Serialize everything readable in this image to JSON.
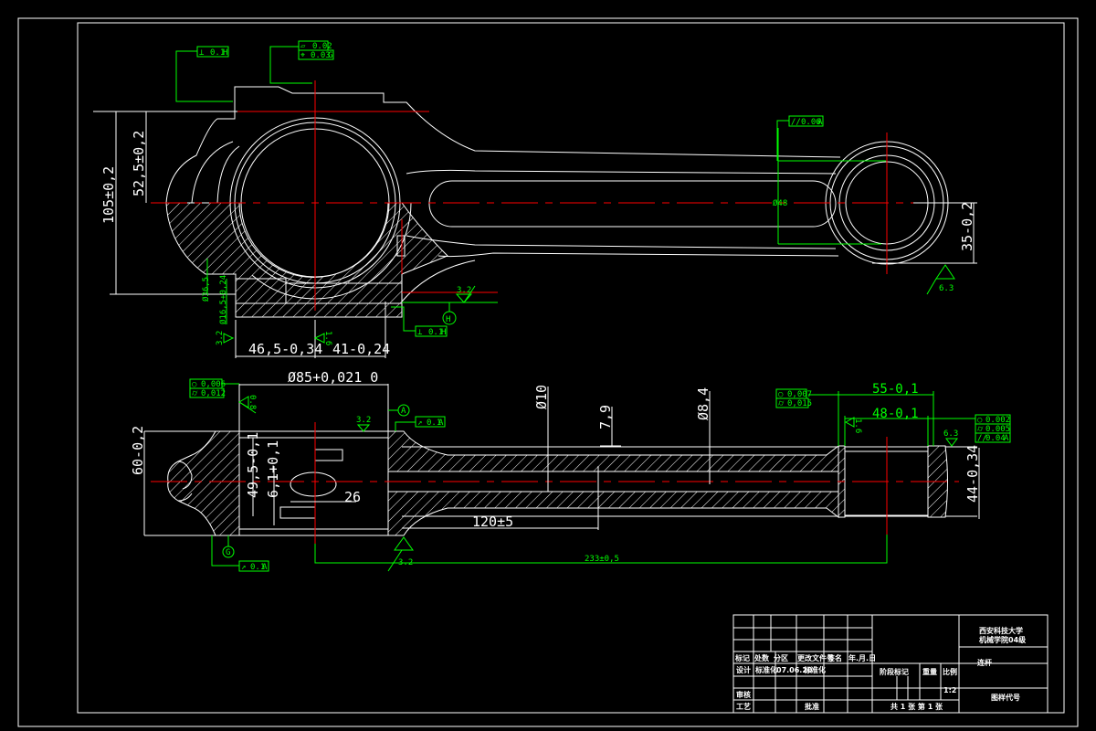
{
  "drawing": {
    "colors": {
      "outline": "#ffffff",
      "centerline": "#ff0000",
      "annotation": "#00ff00",
      "background": "#000000"
    },
    "top_view": {
      "dims": {
        "total_height": "105±0,2",
        "half_height": "52,5±0,2",
        "left_len": "46,5-0,34",
        "right_len": "41-0,24",
        "small_end_height": "35-0,2",
        "bolt_dia_a": "Ø16,5+0,24",
        "bolt_dia_b": "Ø36,5",
        "small_dia": "Ø48"
      },
      "tolerance_frames": [
        {
          "symbol": "⊥",
          "value": "0.1",
          "datum": "H"
        },
        {
          "symbol": "▱",
          "value": "0.02",
          "datum": ""
        },
        {
          "symbol": "⌖",
          "value": "0.03",
          "datum": "G"
        },
        {
          "symbol": "//",
          "value": "0.06",
          "datum": "A"
        },
        {
          "symbol": "⊥",
          "value": "0.1",
          "datum": "H"
        }
      ],
      "roughness": [
        "3.2",
        "3.2",
        "1.6",
        "6.3"
      ],
      "datum": "H"
    },
    "front_view": {
      "dims": {
        "bore": "Ø85+0,021 0",
        "height": "60-0,2",
        "inner": "49,5-0,1",
        "key": "6,1+0,1",
        "width26": "26",
        "oil_hole": "Ø10",
        "d79": "7,9",
        "d84": "Ø8,4",
        "shank": "120±5",
        "center_dist": "233±0,5",
        "small_55": "55-0,1",
        "small_48": "48-0,1",
        "small_44": "44-0,34"
      },
      "tolerance_frames": [
        {
          "symbol": "○",
          "value": "0,006",
          "datum": ""
        },
        {
          "symbol": "⌭",
          "value": "0,012",
          "datum": ""
        },
        {
          "symbol": "↗",
          "value": "0.1",
          "datum": "A"
        },
        {
          "symbol": "↗",
          "value": "0.1",
          "datum": "A"
        },
        {
          "symbol": "○",
          "value": "0,007",
          "datum": ""
        },
        {
          "symbol": "⌭",
          "value": "0,015",
          "datum": ""
        },
        {
          "symbol": "○",
          "value": "0.002",
          "datum": ""
        },
        {
          "symbol": "⌭",
          "value": "0.005",
          "datum": ""
        },
        {
          "symbol": "//",
          "value": "0.04",
          "datum": "A"
        }
      ],
      "roughness": [
        "0.8",
        "3.2",
        "3.2",
        "1.6",
        "6.3"
      ],
      "datums": [
        "A",
        "G"
      ]
    },
    "title_block": {
      "headers": [
        "标记",
        "处数",
        "分区",
        "更改文件号",
        "签名",
        "年.月.日"
      ],
      "row_design": [
        "设计",
        "标准化",
        "07.06.20",
        "标准化"
      ],
      "review": "审核",
      "process": "工艺",
      "approve": "批准",
      "stage": "阶段标记",
      "weight": "重量",
      "scale_label": "比例",
      "scale": "1:2",
      "sheets": "共 1 张 第 1 张",
      "school_1": "西安科技大学",
      "school_2": "机械学院04级",
      "drawing_name": "连杆",
      "drawing_code": "图样代号"
    }
  }
}
